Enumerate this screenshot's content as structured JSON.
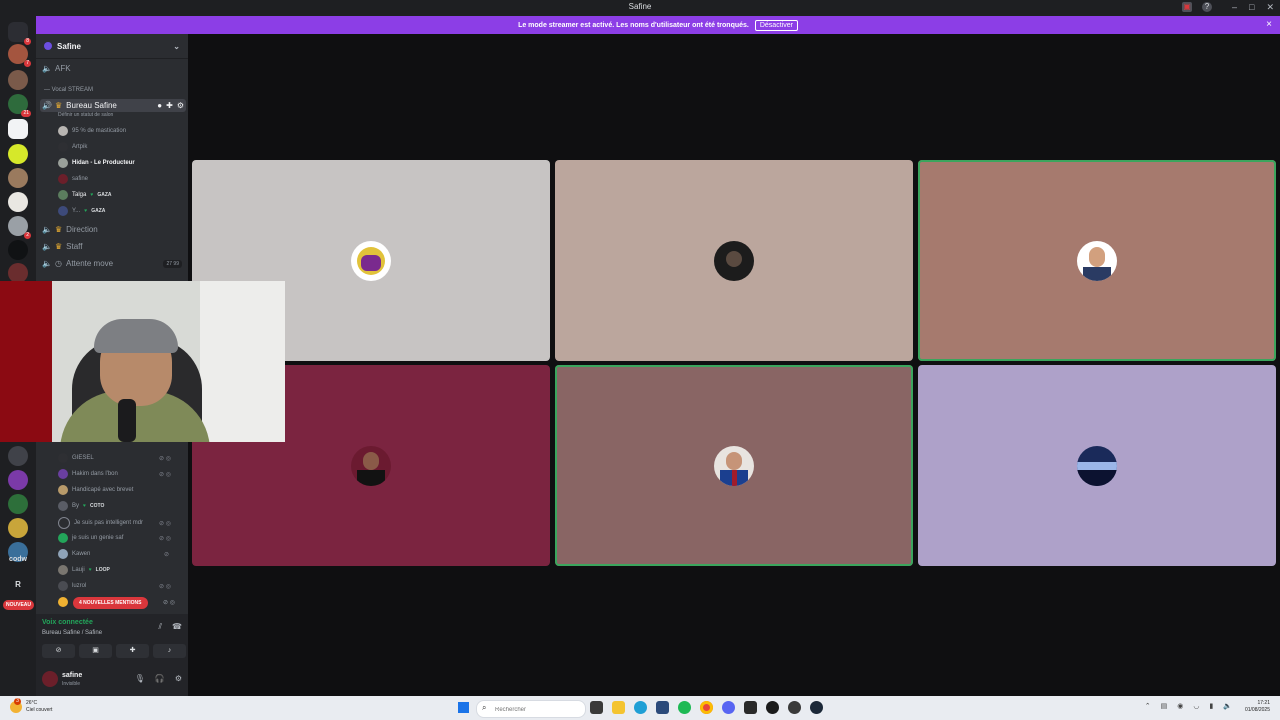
{
  "window": {
    "title": "Safine"
  },
  "banner": {
    "text": "Le mode streamer est activé. Les noms d'utilisateur ont été tronqués.",
    "button": "Désactiver",
    "close": "×"
  },
  "sidebar": {
    "server_badges": [
      "8",
      "7",
      "21",
      "",
      "",
      "",
      "",
      "2"
    ],
    "text_icons": [
      "codw",
      "R"
    ],
    "new_label": "NOUVEAU"
  },
  "guild": {
    "name": "Safine",
    "chevron": "⌄"
  },
  "channels": {
    "afk": "AFK",
    "category": "— Vocal STREAM",
    "bureau": "Bureau Safine",
    "bureau_status": "Définir un statut de salon",
    "direction": "Direction",
    "staff": "Staff",
    "attente": "Attente move",
    "attente_counts": "27  99",
    "users_top": [
      {
        "name": "95 % de mastication",
        "tag": ""
      },
      {
        "name": "Artpik",
        "tag": ""
      },
      {
        "name": "Hidan - Le Producteur",
        "tag": ""
      },
      {
        "name": "safine",
        "tag": ""
      },
      {
        "name": "Talga",
        "tag": "GAZA"
      },
      {
        "name": "Y...",
        "tag": "GAZA"
      }
    ],
    "users_bottom": [
      {
        "name": "GIESEL",
        "tag": ""
      },
      {
        "name": "Hakim dans l'bon",
        "tag": ""
      },
      {
        "name": "Handicapé avec brevet",
        "tag": ""
      },
      {
        "name": "By",
        "tag": "COTO"
      },
      {
        "name": "Je suis pas intelligent mdr",
        "tag": ""
      },
      {
        "name": "je suis un genie saf",
        "tag": ""
      },
      {
        "name": "Kawen",
        "tag": ""
      },
      {
        "name": "Lauji",
        "tag": "LOOP"
      },
      {
        "name": "luzrol",
        "tag": ""
      }
    ],
    "mentions": "4 NOUVELLES MENTIONS"
  },
  "voice": {
    "connected": "Voix connectée",
    "location": "Bureau Safine / Safine",
    "user_name": "safine",
    "user_status": "Invisible"
  },
  "tiles": {
    "colors": [
      "#c7c4c3",
      "#bba69d",
      "#a67a6e",
      "#7b2440",
      "#896564",
      "#aea1c9"
    ]
  },
  "taskbar": {
    "weather_temp": "26°C",
    "weather_desc": "Ciel couvert",
    "weather_badge": "3",
    "search_placeholder": "Rechercher",
    "time": "17:21",
    "date": "01/08/2025"
  }
}
